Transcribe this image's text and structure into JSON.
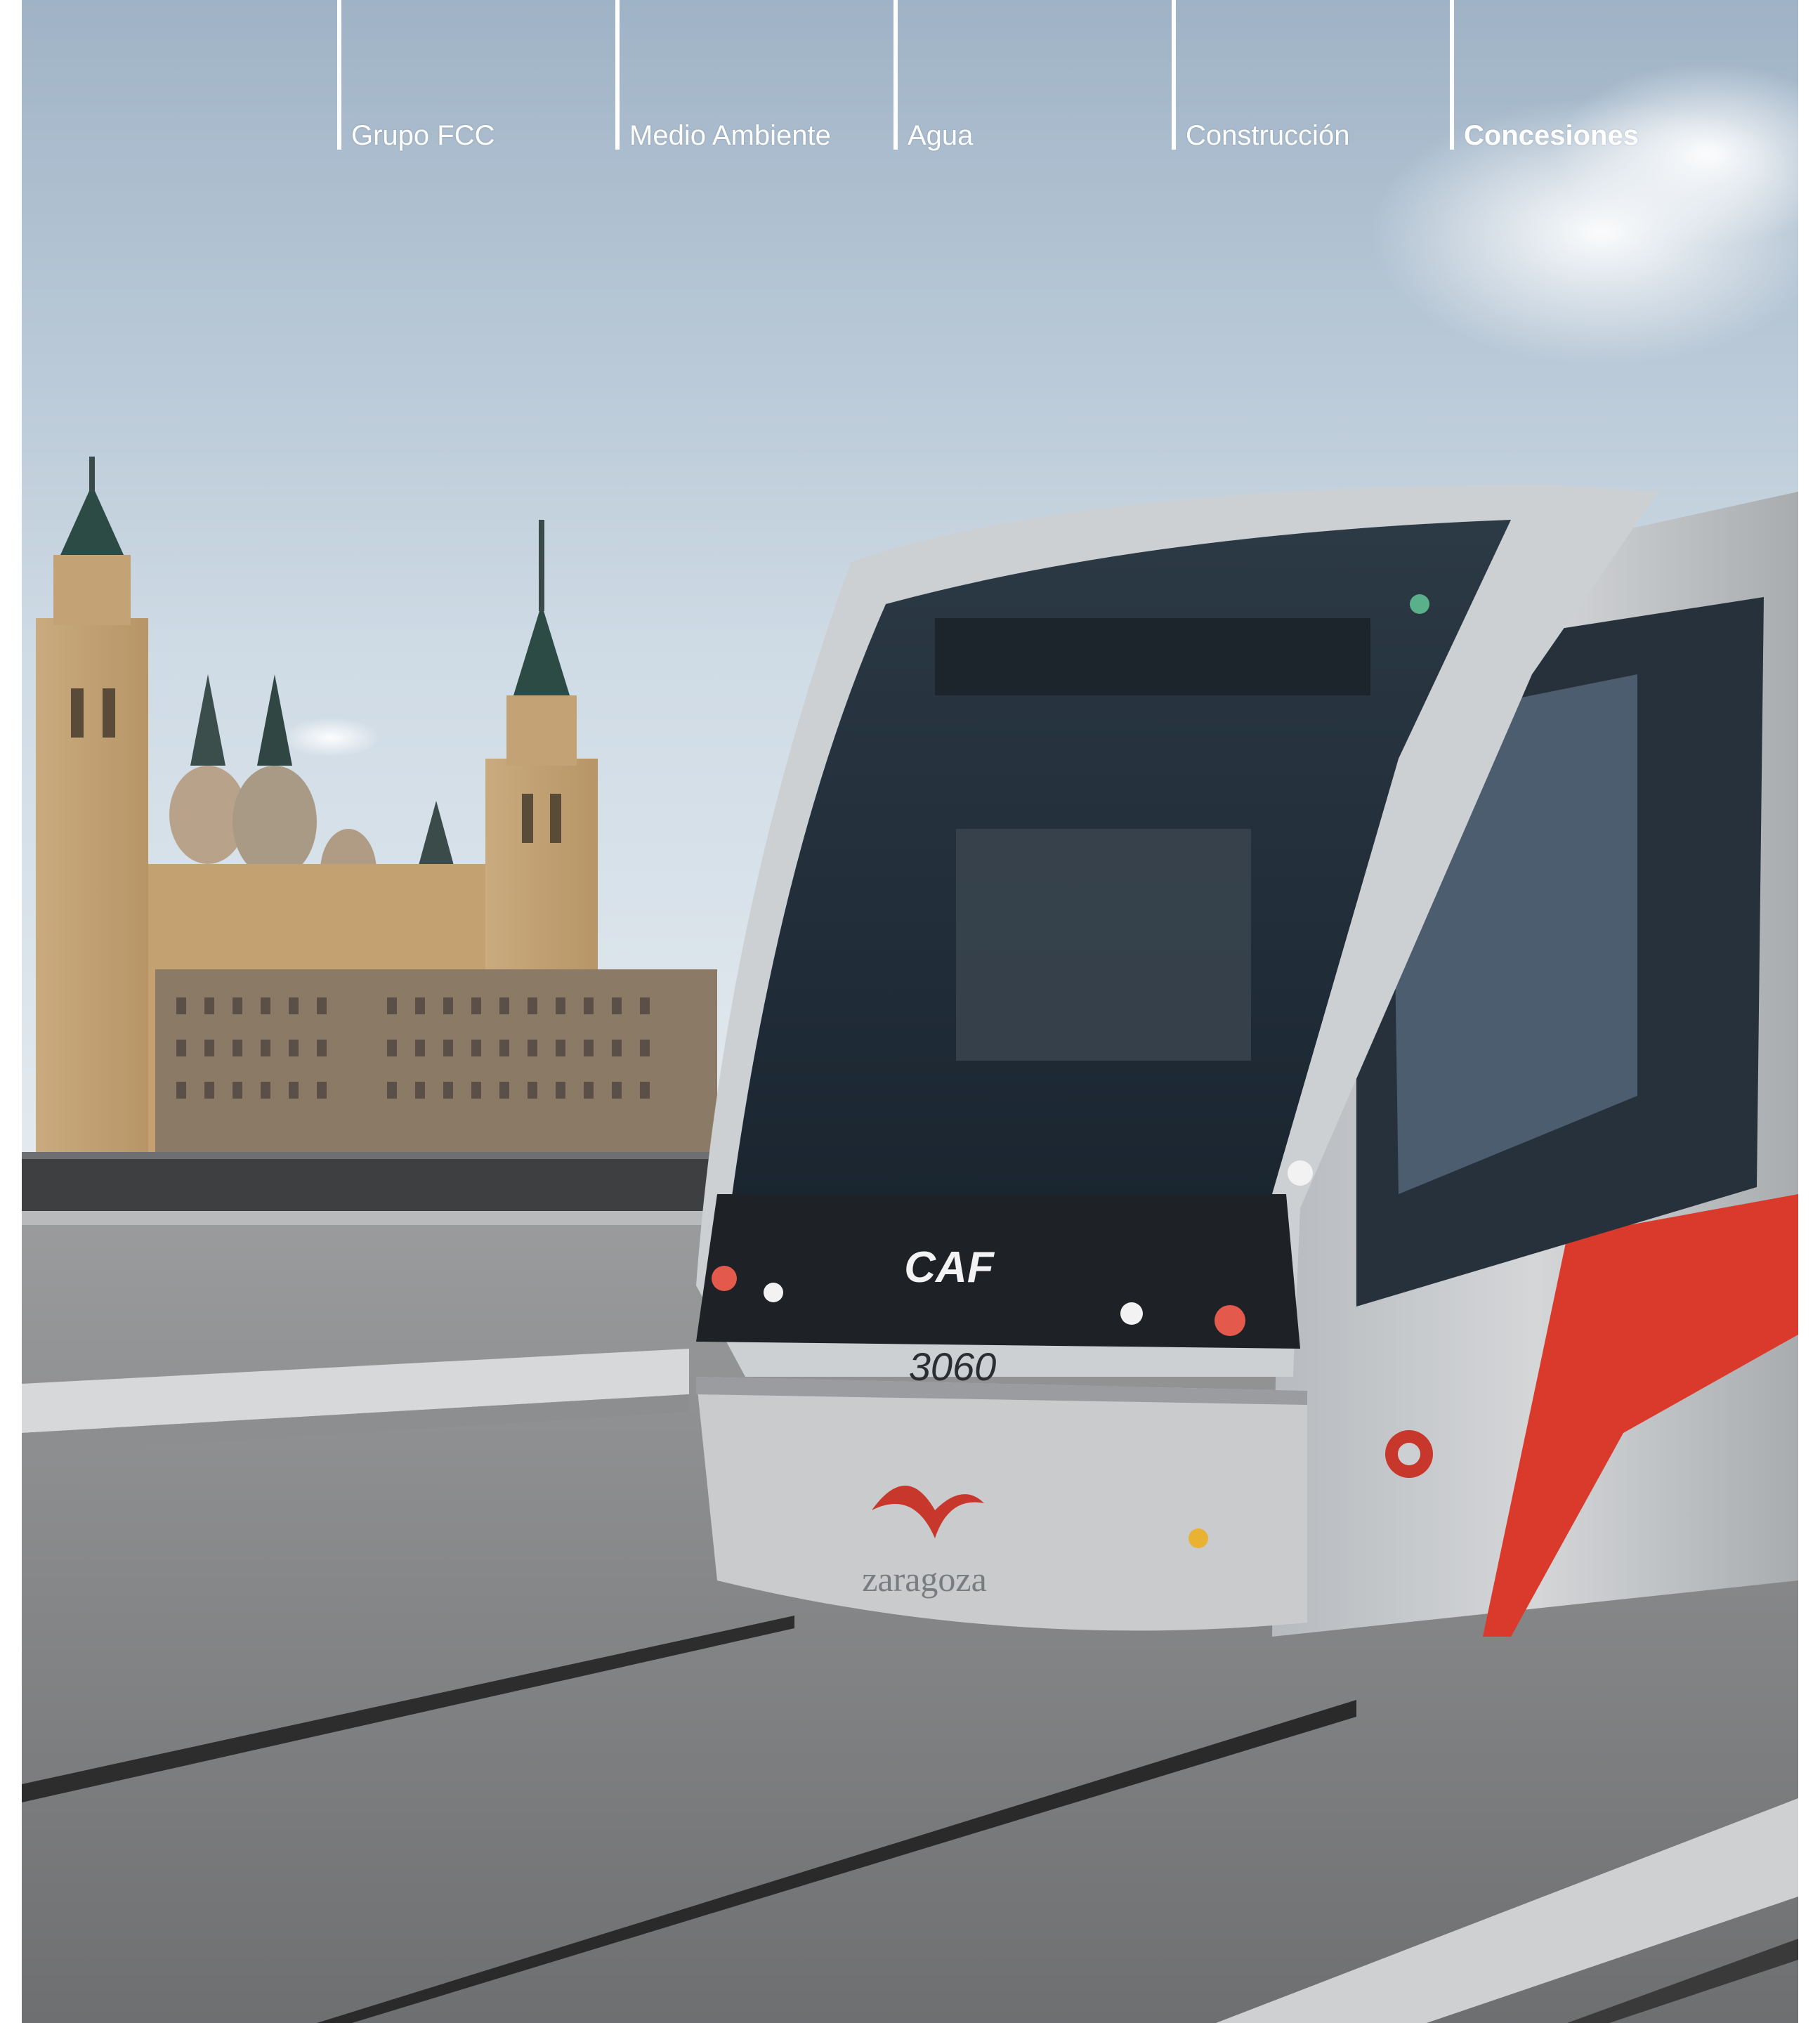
{
  "nav": {
    "items": [
      {
        "label": "Grupo FCC",
        "active": false
      },
      {
        "label": "Medio Ambiente",
        "active": false
      },
      {
        "label": "Agua",
        "active": false
      },
      {
        "label": "Construcción",
        "active": false
      },
      {
        "label": "Concesiones",
        "active": true
      }
    ]
  },
  "photo": {
    "tram_brand": "CAF",
    "tram_number": "3060",
    "tram_logo_text": "zaragoza"
  },
  "colors": {
    "sky_top": "#a3b6c8",
    "sky_bottom": "#dde6ee",
    "tram_red": "#d93a2b",
    "tram_silver": "#c2c5c9",
    "nav_text": "#ffffff"
  }
}
